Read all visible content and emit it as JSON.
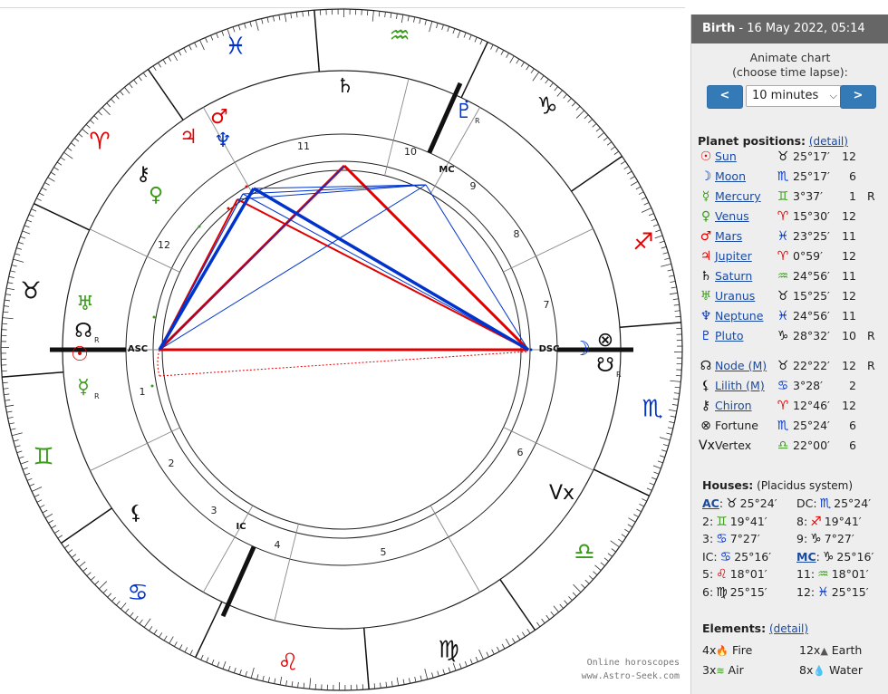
{
  "watermark": {
    "line1": "Online horoscopes",
    "line2": "www.Astro-Seek.com"
  },
  "colors": {
    "red": "#e00000",
    "blue": "#0033cc",
    "green": "#3a9a1a",
    "black": "#111111",
    "sidebar_header": "#666666",
    "button": "#337ab7"
  },
  "chart": {
    "house_numbers": [
      "1",
      "2",
      "3",
      "4",
      "5",
      "6",
      "7",
      "8",
      "9",
      "10",
      "11",
      "12"
    ],
    "angle_labels": {
      "asc": "ASC",
      "dsc": "DSC",
      "mc": "MC",
      "ic": "IC"
    },
    "zodiac_ring": [
      {
        "glyph": "♓",
        "color": "#0033cc"
      },
      {
        "glyph": "♒",
        "color": "#3a9a1a"
      },
      {
        "glyph": "♑",
        "color": "#111111"
      },
      {
        "glyph": "♐",
        "color": "#e00000"
      },
      {
        "glyph": "♏",
        "color": "#0033cc"
      },
      {
        "glyph": "♎",
        "color": "#3a9a1a"
      },
      {
        "glyph": "♍",
        "color": "#111111"
      },
      {
        "glyph": "♌",
        "color": "#e00000"
      },
      {
        "glyph": "♋",
        "color": "#0033cc"
      },
      {
        "glyph": "♊",
        "color": "#3a9a1a"
      },
      {
        "glyph": "♉",
        "color": "#111111"
      },
      {
        "glyph": "♈",
        "color": "#e00000"
      }
    ],
    "planet_glyphs": [
      {
        "glyph": "♇",
        "color": "#0033cc",
        "retro": "R"
      },
      {
        "glyph": "♄",
        "color": "#111111",
        "retro": ""
      },
      {
        "glyph": "♂",
        "color": "#e00000",
        "retro": ""
      },
      {
        "glyph": "♃",
        "color": "#e00000",
        "retro": ""
      },
      {
        "glyph": "♆",
        "color": "#0033cc",
        "retro": ""
      },
      {
        "glyph": "⚷",
        "color": "#111111",
        "retro": ""
      },
      {
        "glyph": "♀",
        "color": "#3a9a1a",
        "retro": ""
      },
      {
        "glyph": "♅",
        "color": "#3a9a1a",
        "retro": ""
      },
      {
        "glyph": "☊",
        "color": "#111111",
        "retro": "R"
      },
      {
        "glyph": "☉",
        "color": "#e00000",
        "retro": ""
      },
      {
        "glyph": "☿",
        "color": "#3a9a1a",
        "retro": "R"
      },
      {
        "glyph": "⚸",
        "color": "#111111",
        "retro": ""
      },
      {
        "glyph": "☽",
        "color": "#0033cc",
        "retro": ""
      },
      {
        "glyph": "⊗",
        "color": "#111111",
        "retro": ""
      },
      {
        "glyph": "☋",
        "color": "#111111",
        "retro": "R"
      },
      {
        "glyph": "Vx",
        "color": "#111111",
        "retro": ""
      }
    ]
  },
  "sidebar": {
    "header": {
      "title": "Birth",
      "date": " - 16 May 2022, 05:14"
    },
    "animate": {
      "line1": "Animate chart",
      "line2": "(choose time lapse):",
      "prev": "<",
      "next": ">",
      "lapse": "10 minutes"
    },
    "planets_title": "Planet positions:",
    "detail_link": "(detail)",
    "planets": [
      {
        "glyph": "☉",
        "color": "#e00000",
        "name": "Sun",
        "link": true,
        "sign": "♉",
        "sign_color": "#111111",
        "deg": "25°17′",
        "house": "12",
        "retro": ""
      },
      {
        "glyph": "☽",
        "color": "#0033cc",
        "name": "Moon",
        "link": true,
        "sign": "♏",
        "sign_color": "#0033cc",
        "deg": "25°17′",
        "house": "6",
        "retro": ""
      },
      {
        "glyph": "☿",
        "color": "#3a9a1a",
        "name": "Mercury",
        "link": true,
        "sign": "♊",
        "sign_color": "#3a9a1a",
        "deg": "3°37′",
        "house": "1",
        "retro": "R"
      },
      {
        "glyph": "♀",
        "color": "#3a9a1a",
        "name": "Venus",
        "link": true,
        "sign": "♈",
        "sign_color": "#e00000",
        "deg": "15°30′",
        "house": "12",
        "retro": ""
      },
      {
        "glyph": "♂",
        "color": "#e00000",
        "name": "Mars",
        "link": true,
        "sign": "♓",
        "sign_color": "#0033cc",
        "deg": "23°25′",
        "house": "11",
        "retro": ""
      },
      {
        "glyph": "♃",
        "color": "#e00000",
        "name": "Jupiter",
        "link": true,
        "sign": "♈",
        "sign_color": "#e00000",
        "deg": "0°59′",
        "house": "12",
        "retro": ""
      },
      {
        "glyph": "♄",
        "color": "#111111",
        "name": "Saturn",
        "link": true,
        "sign": "♒",
        "sign_color": "#3a9a1a",
        "deg": "24°56′",
        "house": "11",
        "retro": ""
      },
      {
        "glyph": "♅",
        "color": "#3a9a1a",
        "name": "Uranus",
        "link": true,
        "sign": "♉",
        "sign_color": "#111111",
        "deg": "15°25′",
        "house": "12",
        "retro": ""
      },
      {
        "glyph": "♆",
        "color": "#0033cc",
        "name": "Neptune",
        "link": true,
        "sign": "♓",
        "sign_color": "#0033cc",
        "deg": "24°56′",
        "house": "11",
        "retro": ""
      },
      {
        "glyph": "♇",
        "color": "#0033cc",
        "name": "Pluto",
        "link": true,
        "sign": "♑",
        "sign_color": "#111111",
        "deg": "28°32′",
        "house": "10",
        "retro": "R"
      },
      {
        "glyph": "☊",
        "color": "#111111",
        "name": "Node (M)",
        "link": true,
        "sign": "♉",
        "sign_color": "#111111",
        "deg": "22°22′",
        "house": "12",
        "retro": "R"
      },
      {
        "glyph": "⚸",
        "color": "#111111",
        "name": "Lilith (M)",
        "link": true,
        "sign": "♋",
        "sign_color": "#0033cc",
        "deg": "3°28′",
        "house": "2",
        "retro": ""
      },
      {
        "glyph": "⚷",
        "color": "#111111",
        "name": "Chiron",
        "link": true,
        "sign": "♈",
        "sign_color": "#e00000",
        "deg": "12°46′",
        "house": "12",
        "retro": ""
      },
      {
        "glyph": "⊗",
        "color": "#111111",
        "name": "Fortune",
        "link": false,
        "sign": "♏",
        "sign_color": "#0033cc",
        "deg": "25°24′",
        "house": "6",
        "retro": ""
      },
      {
        "glyph": "Vx",
        "color": "#111111",
        "name": "Vertex",
        "link": false,
        "sign": "♎",
        "sign_color": "#3a9a1a",
        "deg": "22°00′",
        "house": "6",
        "retro": ""
      }
    ],
    "houses_title": "Houses:",
    "houses_system": "(Placidus system)",
    "houses": [
      {
        "left": {
          "label": "AC",
          "underline": true,
          "sign": "♉",
          "sign_color": "#111111",
          "deg": "25°24′"
        },
        "right": {
          "label": "DC",
          "underline": false,
          "sign": "♏",
          "sign_color": "#0033cc",
          "deg": "25°24′"
        }
      },
      {
        "left": {
          "label": "2",
          "underline": false,
          "sign": "♊",
          "sign_color": "#3a9a1a",
          "deg": "19°41′"
        },
        "right": {
          "label": "8",
          "underline": false,
          "sign": "♐",
          "sign_color": "#e00000",
          "deg": "19°41′"
        }
      },
      {
        "left": {
          "label": "3",
          "underline": false,
          "sign": "♋",
          "sign_color": "#0033cc",
          "deg": "7°27′"
        },
        "right": {
          "label": "9",
          "underline": false,
          "sign": "♑",
          "sign_color": "#111111",
          "deg": "7°27′"
        }
      },
      {
        "left": {
          "label": "IC",
          "underline": false,
          "sign": "♋",
          "sign_color": "#0033cc",
          "deg": "25°16′"
        },
        "right": {
          "label": "MC",
          "underline": true,
          "sign": "♑",
          "sign_color": "#111111",
          "deg": "25°16′"
        }
      },
      {
        "left": {
          "label": "5",
          "underline": false,
          "sign": "♌",
          "sign_color": "#e00000",
          "deg": "18°01′"
        },
        "right": {
          "label": "11",
          "underline": false,
          "sign": "♒",
          "sign_color": "#3a9a1a",
          "deg": "18°01′"
        }
      },
      {
        "left": {
          "label": "6",
          "underline": false,
          "sign": "♍",
          "sign_color": "#111111",
          "deg": "25°15′"
        },
        "right": {
          "label": "12",
          "underline": false,
          "sign": "♓",
          "sign_color": "#0033cc",
          "deg": "25°15′"
        }
      }
    ],
    "elements_title": "Elements:",
    "elements": [
      {
        "count": "4x",
        "icon": "🔥",
        "icon_color": "#e05020",
        "name": "Fire",
        "count2": "12x",
        "icon2": "▲",
        "icon2_color": "#555555",
        "name2": "Earth"
      },
      {
        "count": "3x",
        "icon": "≋",
        "icon_color": "#3a9a1a",
        "name": "Air",
        "count2": "8x",
        "icon2": "💧",
        "icon2_color": "#1a6ad0",
        "name2": "Water"
      }
    ]
  }
}
